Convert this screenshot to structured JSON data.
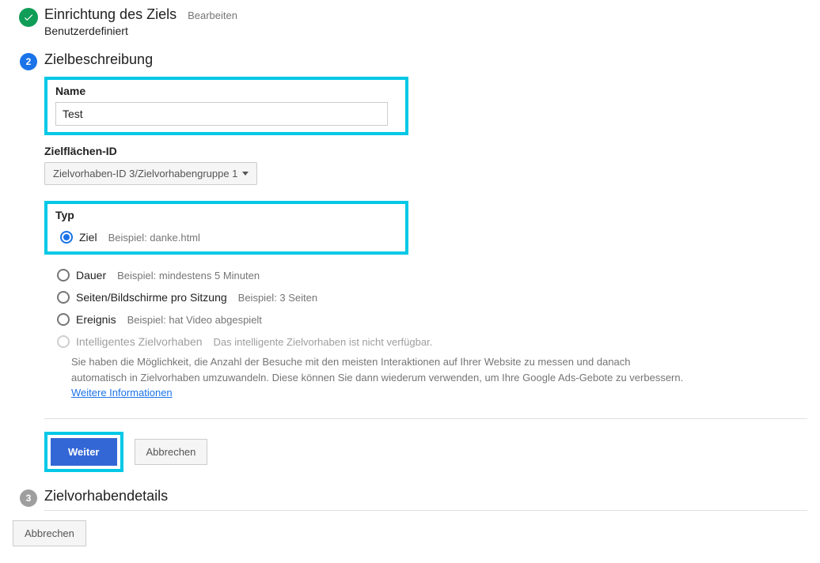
{
  "step1": {
    "title": "Einrichtung des Ziels",
    "edit": "Bearbeiten",
    "subtitle": "Benutzerdefiniert"
  },
  "step2": {
    "number": "2",
    "title": "Zielbeschreibung",
    "name_label": "Name",
    "name_value": "Test",
    "slot_label": "Zielflächen-ID",
    "slot_value": "Zielvorhaben-ID 3/Zielvorhabengruppe 1",
    "type_label": "Typ",
    "options": [
      {
        "label": "Ziel",
        "example": "Beispiel: danke.html"
      },
      {
        "label": "Dauer",
        "example": "Beispiel: mindestens 5 Minuten"
      },
      {
        "label": "Seiten/Bildschirme pro Sitzung",
        "example": "Beispiel: 3 Seiten"
      },
      {
        "label": "Ereignis",
        "example": "Beispiel: hat Video abgespielt"
      },
      {
        "label": "Intelligentes Zielvorhaben",
        "example": "Das intelligente Zielvorhaben ist nicht verfügbar."
      }
    ],
    "info_text": "Sie haben die Möglichkeit, die Anzahl der Besuche mit den meisten Interaktionen auf Ihrer Website zu messen und danach automatisch in Zielvorhaben umzuwandeln. Diese können Sie dann wiederum verwenden, um Ihre Google Ads-Gebote zu verbessern. ",
    "info_link": "Weitere Informationen",
    "continue_btn": "Weiter",
    "cancel_btn": "Abbrechen"
  },
  "step3": {
    "number": "3",
    "title": "Zielvorhabendetails"
  },
  "bottom": {
    "cancel": "Abbrechen"
  }
}
